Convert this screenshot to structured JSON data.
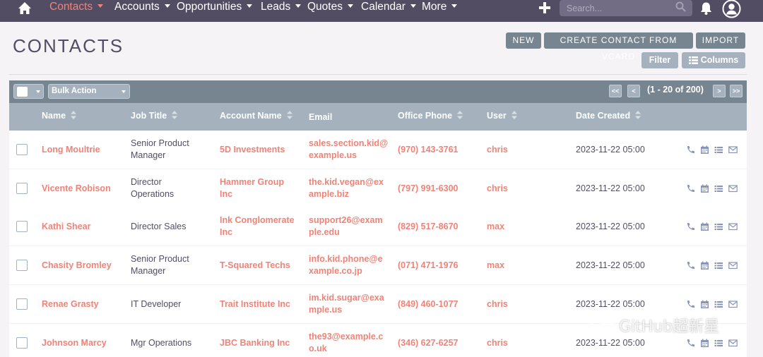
{
  "nav": {
    "items": [
      {
        "label": "Contacts",
        "active": true
      },
      {
        "label": "Accounts"
      },
      {
        "label": "Opportunities"
      },
      {
        "label": "Leads"
      },
      {
        "label": "Quotes"
      },
      {
        "label": "Calendar"
      },
      {
        "label": "More"
      }
    ],
    "search_placeholder": "Search...",
    "icons": [
      "home-icon",
      "plus-icon",
      "search-icon",
      "bell-icon",
      "user-icon"
    ]
  },
  "page": {
    "title": "CONTACTS",
    "buttons": {
      "new": "NEW",
      "create_vcard": "CREATE CONTACT FROM VCARD",
      "import": "IMPORT",
      "filter": "Filter",
      "columns": "Columns"
    }
  },
  "toolbar": {
    "bulk_action": "Bulk Action",
    "first": "<<",
    "prev": "<",
    "next": ">",
    "last": ">>",
    "pagination": "(1 - 20 of 200)"
  },
  "columns": [
    "Name",
    "Job Title",
    "Account Name",
    "Email",
    "Office Phone",
    "User",
    "Date Created"
  ],
  "rows": [
    {
      "name": "Long Moultrie",
      "job": [
        "Senior Product",
        "Manager"
      ],
      "account": [
        "5D Investments"
      ],
      "email": [
        "sales.section.kid@",
        "example.us"
      ],
      "phone": "(970) 143-3761",
      "user": "chris",
      "date": "2023-11-22 05:00"
    },
    {
      "name": "Vicente Robison",
      "job": [
        "Director",
        "Operations"
      ],
      "account": [
        "Hammer Group",
        "Inc"
      ],
      "email": [
        "the.kid.vegan@ex",
        "ample.biz"
      ],
      "phone": "(797) 991-6300",
      "user": "chris",
      "date": "2023-11-22 05:00"
    },
    {
      "name": "Kathi Shear",
      "job": [
        "Director Sales"
      ],
      "account": [
        "Ink Conglomerate",
        "Inc"
      ],
      "email": [
        "support26@exam",
        "ple.edu"
      ],
      "phone": "(829) 517-8670",
      "user": "max",
      "date": "2023-11-22 05:00"
    },
    {
      "name": "Chasity Bromley",
      "job": [
        "Senior Product",
        "Manager"
      ],
      "account": [
        "T-Squared Techs"
      ],
      "email": [
        "info.kid.phone@e",
        "xample.co.jp"
      ],
      "phone": "(071) 471-1976",
      "user": "max",
      "date": "2023-11-22 05:00"
    },
    {
      "name": "Renae Grasty",
      "job": [
        "IT Developer"
      ],
      "account": [
        "Trait Institute Inc"
      ],
      "email": [
        "im.kid.sugar@exa",
        "mple.us"
      ],
      "phone": "(849) 460-1077",
      "user": "chris",
      "date": "2023-11-22 05:00"
    },
    {
      "name": "Johnson Marcy",
      "job": [
        "Mgr Operations"
      ],
      "account": [
        "JBC Banking Inc"
      ],
      "email": [
        "the93@example.c",
        "o.uk"
      ],
      "phone": "(346) 627-6257",
      "user": "chris",
      "date": "2023-11-22 05:00"
    }
  ],
  "row_actions": [
    "phone-icon",
    "calendar-icon",
    "tasks-icon",
    "email-icon"
  ],
  "colors": {
    "nav_bg": "#534d64",
    "accent": "#f08377",
    "toolbar": "#778591",
    "header": "#a5b2bd"
  },
  "watermark": "GitHub超新星"
}
